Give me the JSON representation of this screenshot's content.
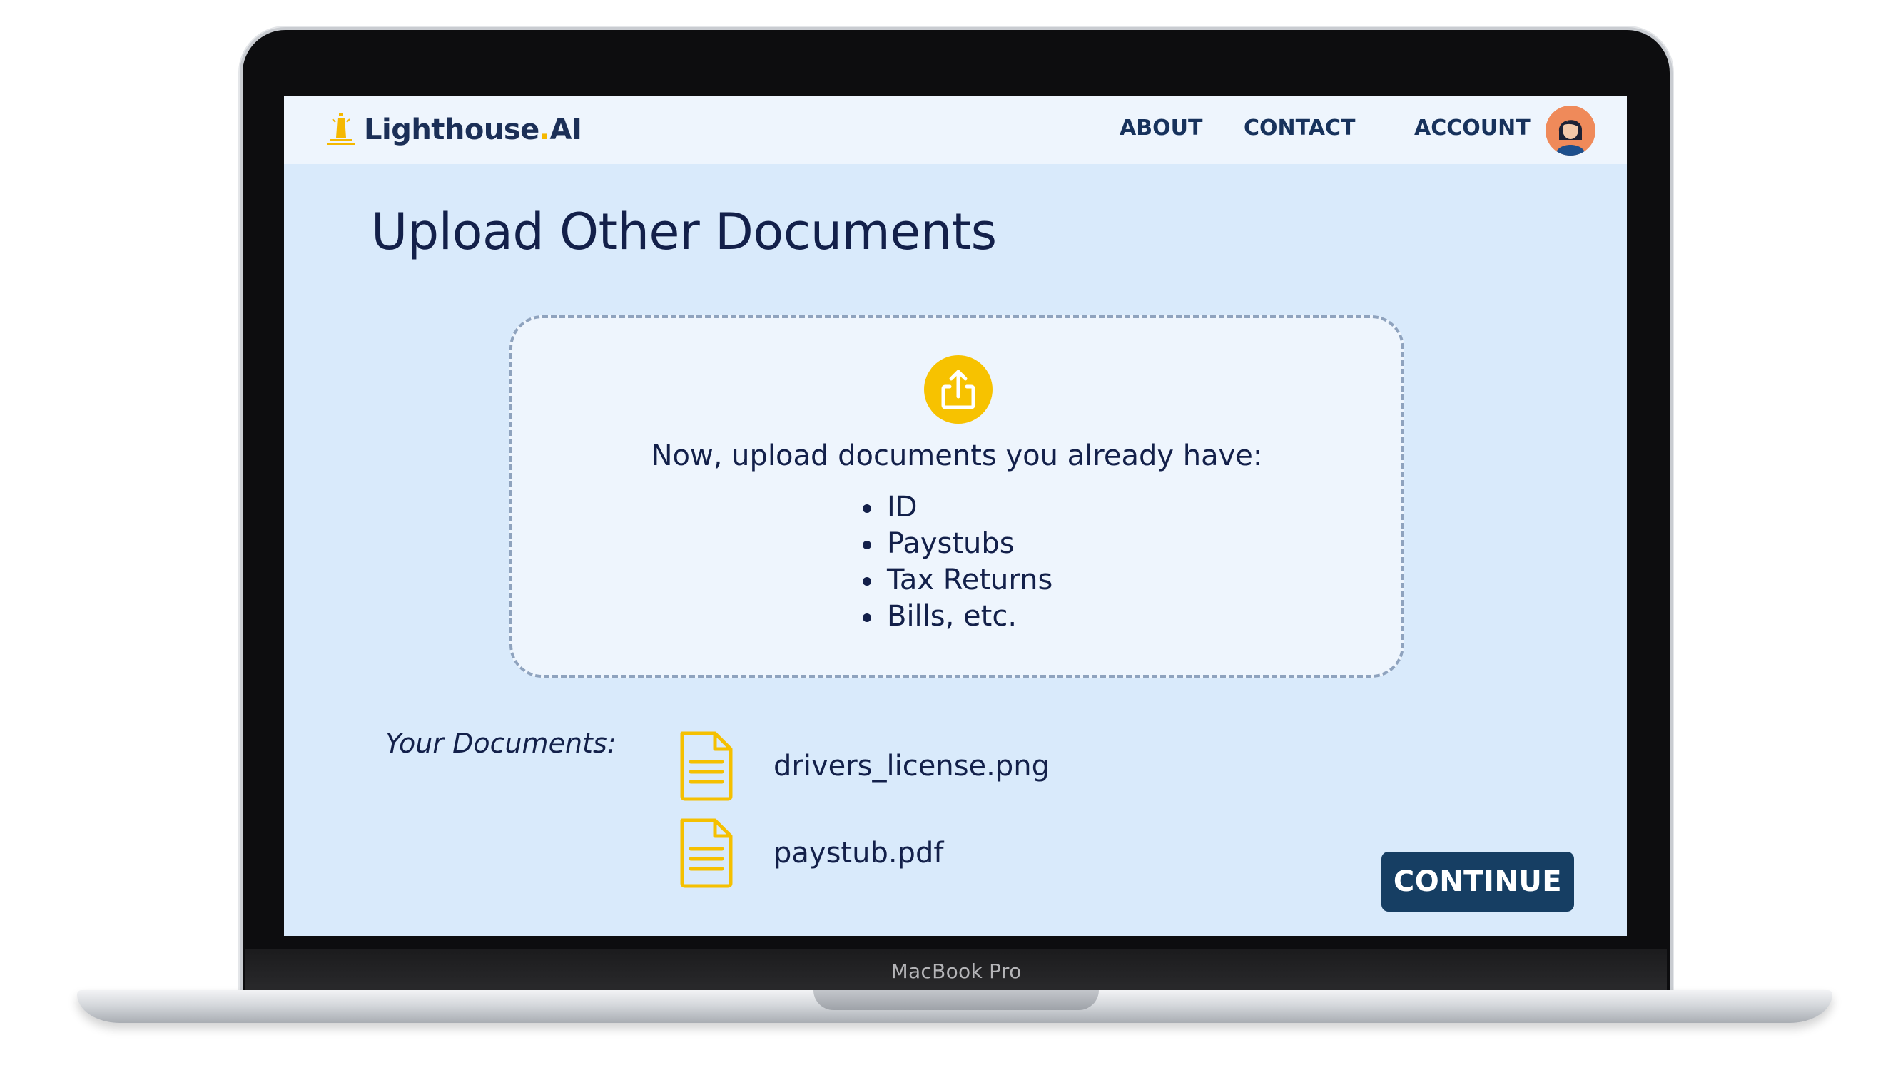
{
  "device": {
    "label": "MacBook Pro"
  },
  "nav": {
    "brand_name": "Lighthouse",
    "brand_dot": ".",
    "brand_suffix": "AI",
    "links": [
      {
        "label": "ABOUT"
      },
      {
        "label": "CONTACT"
      },
      {
        "label": "ACCOUNT"
      }
    ],
    "avatar_icon": "user-avatar-icon"
  },
  "page": {
    "title": "Upload Other Documents"
  },
  "dropzone": {
    "icon": "upload-icon",
    "heading": "Now, upload documents you already have:",
    "items": [
      "ID",
      "Paystubs",
      "Tax Returns",
      "Bills, etc."
    ]
  },
  "documents": {
    "label": "Your Documents:",
    "files": [
      {
        "name": "drivers_license.png",
        "icon": "document-icon"
      },
      {
        "name": "paystub.pdf",
        "icon": "document-icon"
      }
    ]
  },
  "actions": {
    "continue_label": "CONTINUE"
  },
  "colors": {
    "screen_bg": "#d9eafb",
    "navbar_bg": "#eef5fd",
    "primary_text": "#13204a",
    "accent_yellow": "#f7c200",
    "button_bg": "#163e63",
    "dashed_border": "#8fa3be"
  }
}
